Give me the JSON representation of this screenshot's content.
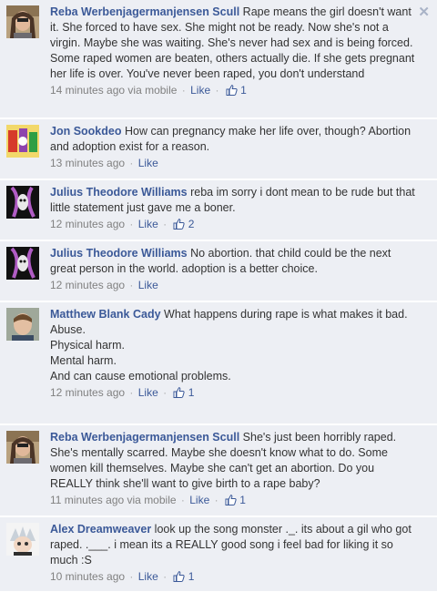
{
  "thread": {
    "close_label": "✕",
    "like_label": "Like",
    "comments": [
      {
        "author": "Reba Werbenjagermanjensen Scull",
        "text": "Rape means the girl doesn't want it. She forced to have sex. She might not be ready. Now she's not a virgin. Maybe she was waiting. She's never had sex and is being forced. Some raped women are beaten, others actually die. If she gets pregnant her life is over. You've never been raped, you don't understand",
        "time": "14 minutes ago",
        "via": "via mobile",
        "likes": "1"
      },
      {
        "author": "Jon Sookdeo",
        "text": "How can pregnancy make her life over, though? Abortion and adoption exist for a reason.",
        "time": "13 minutes ago",
        "via": "",
        "likes": ""
      },
      {
        "author": "Julius Theodore Williams",
        "text": "reba im sorry i dont mean to be rude but that little statement just gave me a boner.",
        "time": "12 minutes ago",
        "via": "",
        "likes": "2"
      },
      {
        "author": "Julius Theodore Williams",
        "text": "No abortion. that child could be the next great person in the world. adoption is a better choice.",
        "time": "12 minutes ago",
        "via": "",
        "likes": ""
      },
      {
        "author": "Matthew Blank Cady",
        "text": "What happens during rape is what makes it bad.",
        "extra_lines": [
          "Abuse.",
          "Physical harm.",
          "Mental harm.",
          "And can cause emotional problems."
        ],
        "time": "12 minutes ago",
        "via": "",
        "likes": "1"
      },
      {
        "author": "Reba Werbenjagermanjensen Scull",
        "text": "She's just been horribly raped. She's mentally scarred. Maybe she doesn't know what to do. Some women kill themselves. Maybe she can't get an abortion. Do you REALLY think she'll want to give birth to a rape baby?",
        "time": "11 minutes ago",
        "via": "via mobile",
        "likes": "1"
      },
      {
        "author": "Alex Dreamweaver",
        "text": "look up the song monster ._. its about a gil who got raped. .___. i mean its a REALLY good song i feel bad for liking it so much :S",
        "time": "10 minutes ago",
        "via": "",
        "likes": "1"
      }
    ]
  },
  "colors": {
    "background": "#edeff4",
    "link": "#3b5998",
    "meta": "#808080",
    "text": "#333333"
  },
  "icons": {
    "close": "close-icon",
    "like": "thumbs-up-icon"
  }
}
